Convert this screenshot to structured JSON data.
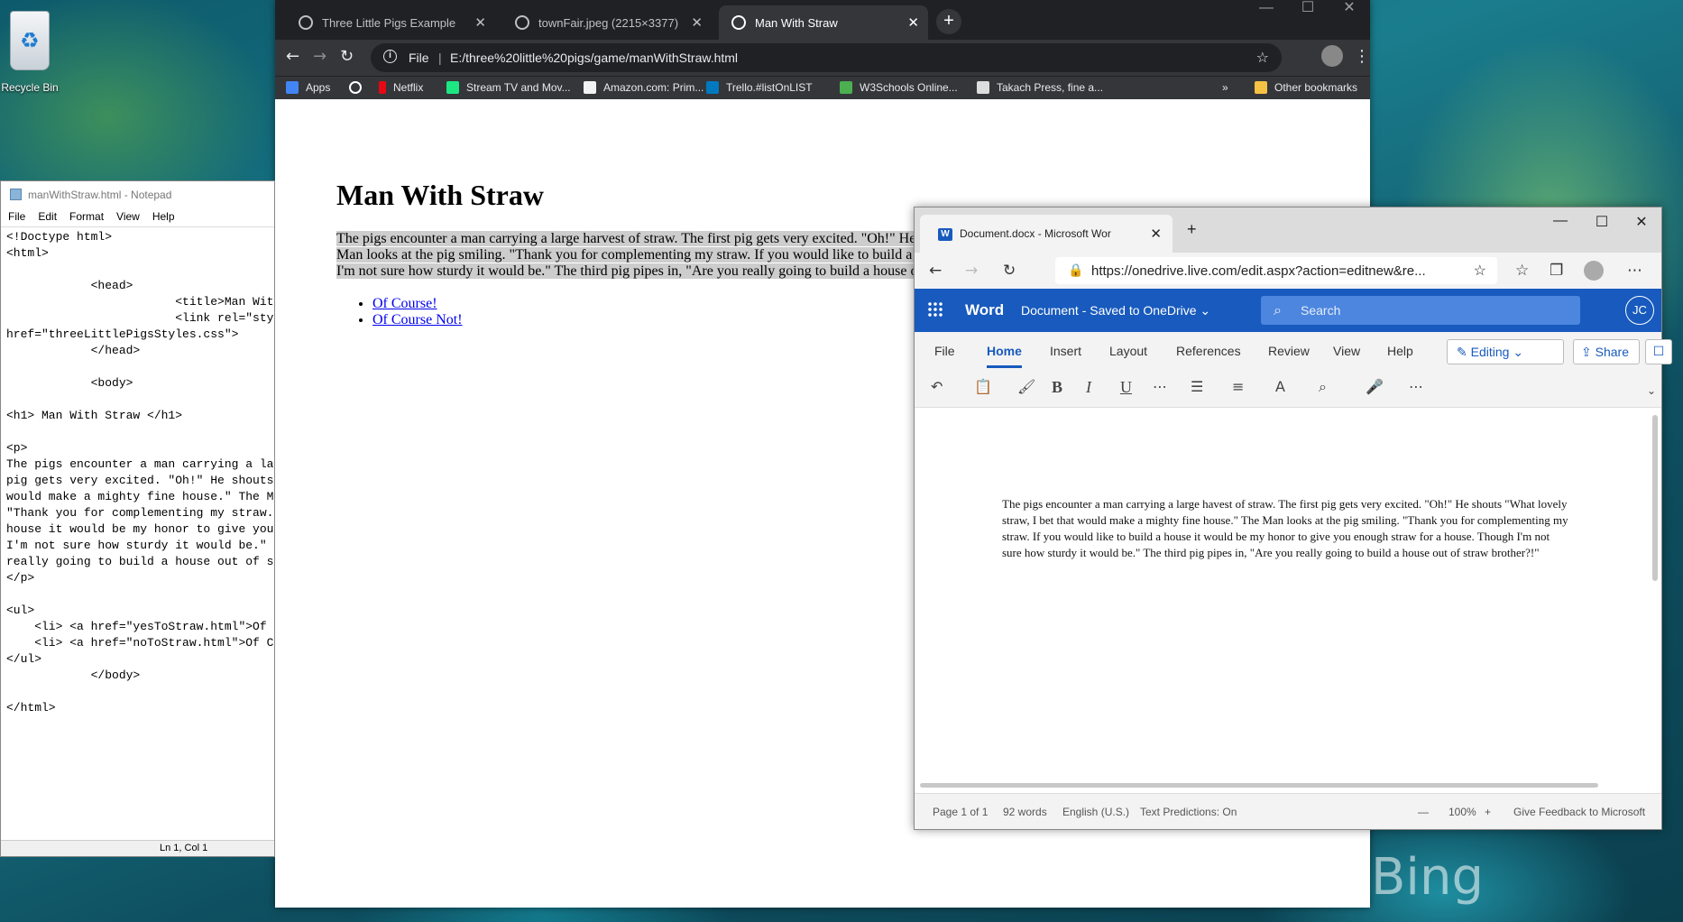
{
  "desktop": {
    "recycle_bin_label": "Recycle Bin",
    "watermark": "Bing"
  },
  "chrome": {
    "tabs": [
      {
        "label": "Three Little Pigs Example"
      },
      {
        "label": "townFair.jpeg (2215×3377)"
      },
      {
        "label": "Man With Straw"
      }
    ],
    "address_scheme": "File",
    "address_url": "E:/three%20little%20pigs/game/manWithStraw.html",
    "bookmarks": [
      {
        "label": "Apps",
        "color": "#4285f4"
      },
      {
        "label": "",
        "color": "#ffffff"
      },
      {
        "label": "Netflix",
        "color": "#e50914"
      },
      {
        "label": "Stream TV and Mov...",
        "color": "#1ce783"
      },
      {
        "label": "Amazon.com: Prim...",
        "color": "#f2f2f2"
      },
      {
        "label": "Trello.#listOnLIST",
        "color": "#0079bf"
      },
      {
        "label": "W3Schools Online...",
        "color": "#4caf50"
      },
      {
        "label": "Takach Press, fine a...",
        "color": "#dddddd"
      }
    ],
    "overflow": "»",
    "other_bookmarks": "Other bookmarks"
  },
  "webpage": {
    "heading": "Man With Straw",
    "paragraph": "The pigs encounter a man carrying a large harvest of straw. The first pig gets very excited. \"Oh!\" He shouts \"What lovely straw, I bet that would make a mighty fine house.\" The Man looks at the pig smiling. \"Thank you for complementing my straw. If you would like to build a house it would be my honor to give you enough straw for a house. Though I'm not sure how sturdy it would be.\" The third pig pipes in, \"Are you really going to build a house out of straw brother?!\"",
    "links": [
      "Of Course!",
      "Of Course Not!"
    ]
  },
  "notepad": {
    "title": "manWithStraw.html - Notepad",
    "menu": [
      "File",
      "Edit",
      "Format",
      "View",
      "Help"
    ],
    "content": "<!Doctype html>\n<html>\n\n            <head>\n                        <title>Man With Straw</title>\n                        <link rel=\"stylesheet\"\nhref=\"threeLittlePigsStyles.css\">\n            </head>\n\n            <body>\n\n<h1> Man With Straw </h1>\n\n<p>\nThe pigs encounter a man carrying a large harvest of straw. The first\npig gets very excited. \"Oh!\" He shouts \"What lovely straw, I bet that\nwould make a mighty fine house.\" The Man looks at the pig smiling.\n\"Thank you for complementing my straw. If you would like to build a\nhouse it would be my honor to give you enough straw for a house. Though\nI'm not sure how sturdy it would be.\" The third pig pipes in, \"Are you\nreally going to build a house out of straw brother?!\"\n</p>\n\n<ul>\n    <li> <a href=\"yesToStraw.html\">Of Course!</a></li>\n    <li> <a href=\"noToStraw.html\">Of Course Not!</a></li>\n</ul>\n            </body>\n\n</html>",
    "status": "Ln 1, Col 1"
  },
  "edge": {
    "tab_label": "Document.docx - Microsoft Wor",
    "url": "https://onedrive.live.com/edit.aspx?action=editnew&re..."
  },
  "word": {
    "brand": "Word",
    "doc_title": "Document - Saved to OneDrive ⌄",
    "search_placeholder": "Search",
    "avatar": "JC",
    "ribbon_tabs": [
      "File",
      "Home",
      "Insert",
      "Layout",
      "References",
      "Review",
      "View",
      "Help"
    ],
    "editing": "✎ Editing ⌄",
    "share": "⇪ Share",
    "body_text": "The pigs encounter a man carrying a large havest of straw. The first pig gets very excited. \"Oh!\" He shouts \"What lovely straw, I bet that would make a mighty fine house.\" The Man looks at the pig smiling. \"Thank you for complementing my straw. If you would like to build a house it would be my honor to give you enough straw for a house. Though I'm not sure how sturdy it would be.\" The third pig pipes in, \"Are you really going to build a house out of straw brother?!\"",
    "status": {
      "page": "Page 1 of 1",
      "words": "92 words",
      "language": "English (U.S.)",
      "predictions": "Text Predictions: On",
      "zoom": "100%",
      "feedback": "Give Feedback to Microsoft"
    }
  }
}
